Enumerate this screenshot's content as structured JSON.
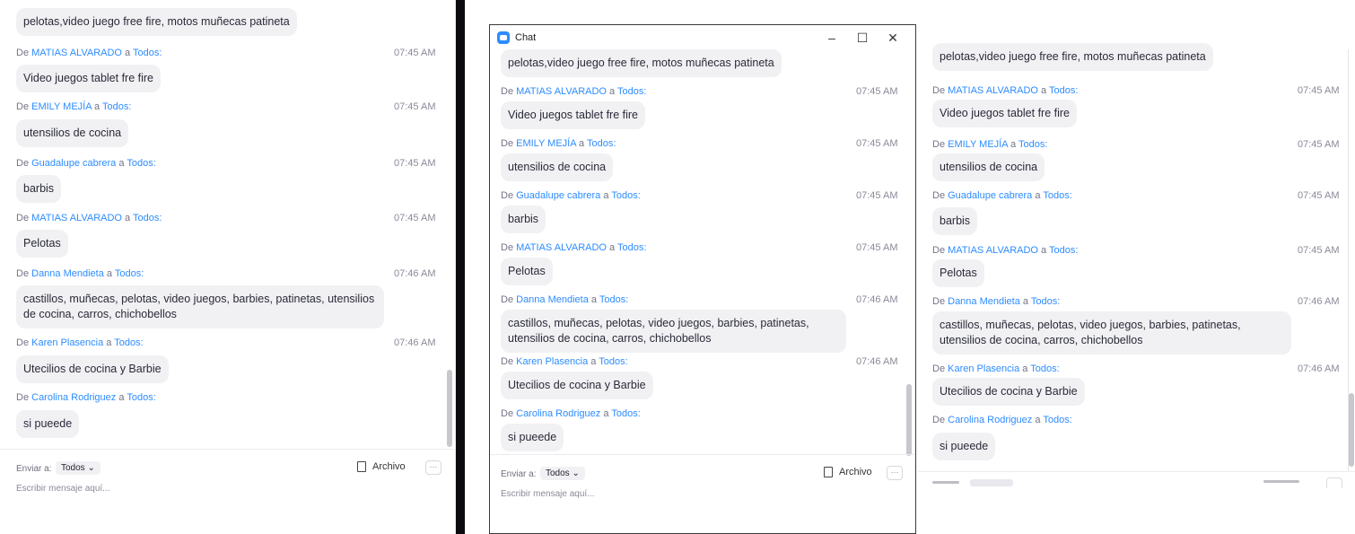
{
  "window": {
    "title": "Chat",
    "minimize_glyph": "–",
    "maximize_glyph": "☐",
    "close_glyph": "✕"
  },
  "from_prefix": "De",
  "to_word": "a",
  "messages": [
    {
      "sender": "",
      "to": "",
      "time": "",
      "text": "pelotas,video juego free fire, motos muñecas patineta"
    },
    {
      "sender": "MATIAS ALVARADO",
      "to": "Todos:",
      "time": "07:45 AM",
      "text": "Video juegos tablet fre fire"
    },
    {
      "sender": "EMILY MEJÍA",
      "to": "Todos:",
      "time": "07:45 AM",
      "text": "utensilios de cocina"
    },
    {
      "sender": "Guadalupe cabrera",
      "to": "Todos:",
      "time": "07:45 AM",
      "text": "barbis"
    },
    {
      "sender": "MATIAS ALVARADO",
      "to": "Todos:",
      "time": "07:45 AM",
      "text": "Pelotas"
    },
    {
      "sender": "Danna Mendieta",
      "to": "Todos:",
      "time": "07:46 AM",
      "text": "castillos, muñecas, pelotas, video juegos, barbies, patinetas, utensilios de cocina, carros, chichobellos"
    },
    {
      "sender": "Karen Plasencia",
      "to": "Todos:",
      "time": "07:46 AM",
      "text": "Utecilios de cocina y Barbie"
    },
    {
      "sender": "Carolina Rodriguez",
      "to": "Todos:",
      "time": "",
      "text": "si pueede"
    }
  ],
  "compose": {
    "send_to_label": "Enviar a:",
    "recipient": "Todos",
    "recipient_chevron": "⌄",
    "file_label": "Archivo",
    "more_glyph": "···",
    "placeholder": "Escribir mensaje aquí..."
  },
  "colors": {
    "accent": "#2d8cff",
    "bubble": "#f1f1f4"
  }
}
